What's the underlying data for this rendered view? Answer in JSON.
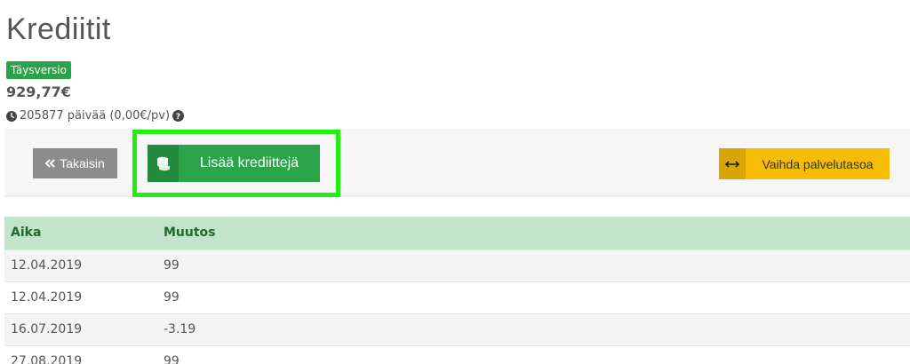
{
  "page": {
    "title": "Krediitit"
  },
  "account": {
    "plan_badge": "Täysversio",
    "balance": "929,77€",
    "days_text": "205877 päivää (0,00€/pv)"
  },
  "toolbar": {
    "back_label": "Takaisin",
    "add_label": "Lisää krediittejä",
    "switch_label": "Vaihda palvelutasoa"
  },
  "table": {
    "headers": [
      "Aika",
      "Muutos"
    ],
    "rows": [
      {
        "date": "12.04.2019",
        "change": "99",
        "sign": "positive"
      },
      {
        "date": "12.04.2019",
        "change": "99",
        "sign": "positive"
      },
      {
        "date": "16.07.2019",
        "change": "-3.19",
        "sign": "negative"
      },
      {
        "date": "27.08.2019",
        "change": "99",
        "sign": "positive"
      }
    ]
  },
  "colors": {
    "accent_green": "#2aa34a",
    "highlight": "#22ee11",
    "warning_yellow": "#f5bd05",
    "negative_red": "#e53935"
  }
}
